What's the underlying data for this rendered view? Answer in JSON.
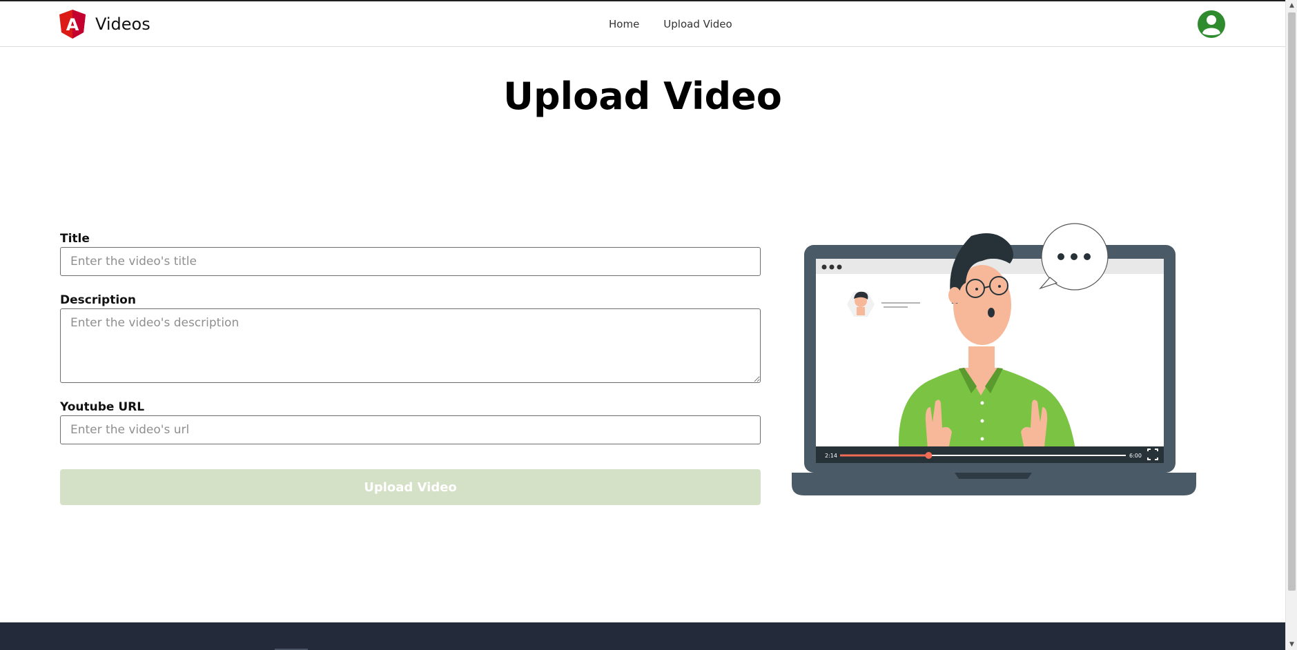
{
  "brand": {
    "name": "Videos",
    "logo_letter": "A",
    "logo_color": "#dd1b16"
  },
  "nav": {
    "items": [
      {
        "label": "Home"
      },
      {
        "label": "Upload Video"
      }
    ]
  },
  "user": {
    "avatar_color": "#2e8b2e"
  },
  "page": {
    "title": "Upload Video"
  },
  "form": {
    "title_label": "Title",
    "title_placeholder": "Enter the video's title",
    "title_value": "",
    "description_label": "Description",
    "description_placeholder": "Enter the video's description",
    "description_value": "",
    "url_label": "Youtube URL",
    "url_placeholder": "Enter the video's url",
    "url_value": "",
    "submit_label": "Upload Video",
    "submit_disabled": true,
    "submit_color": "#d4e1c6"
  },
  "illustration": {
    "player_time_current": "2:14",
    "player_time_total": "6:00",
    "progress_fraction": 0.31,
    "speech_bubble": "..."
  },
  "colors": {
    "footer": "#232a3a",
    "shirt": "#7bc443",
    "laptop": "#4a5a66"
  }
}
